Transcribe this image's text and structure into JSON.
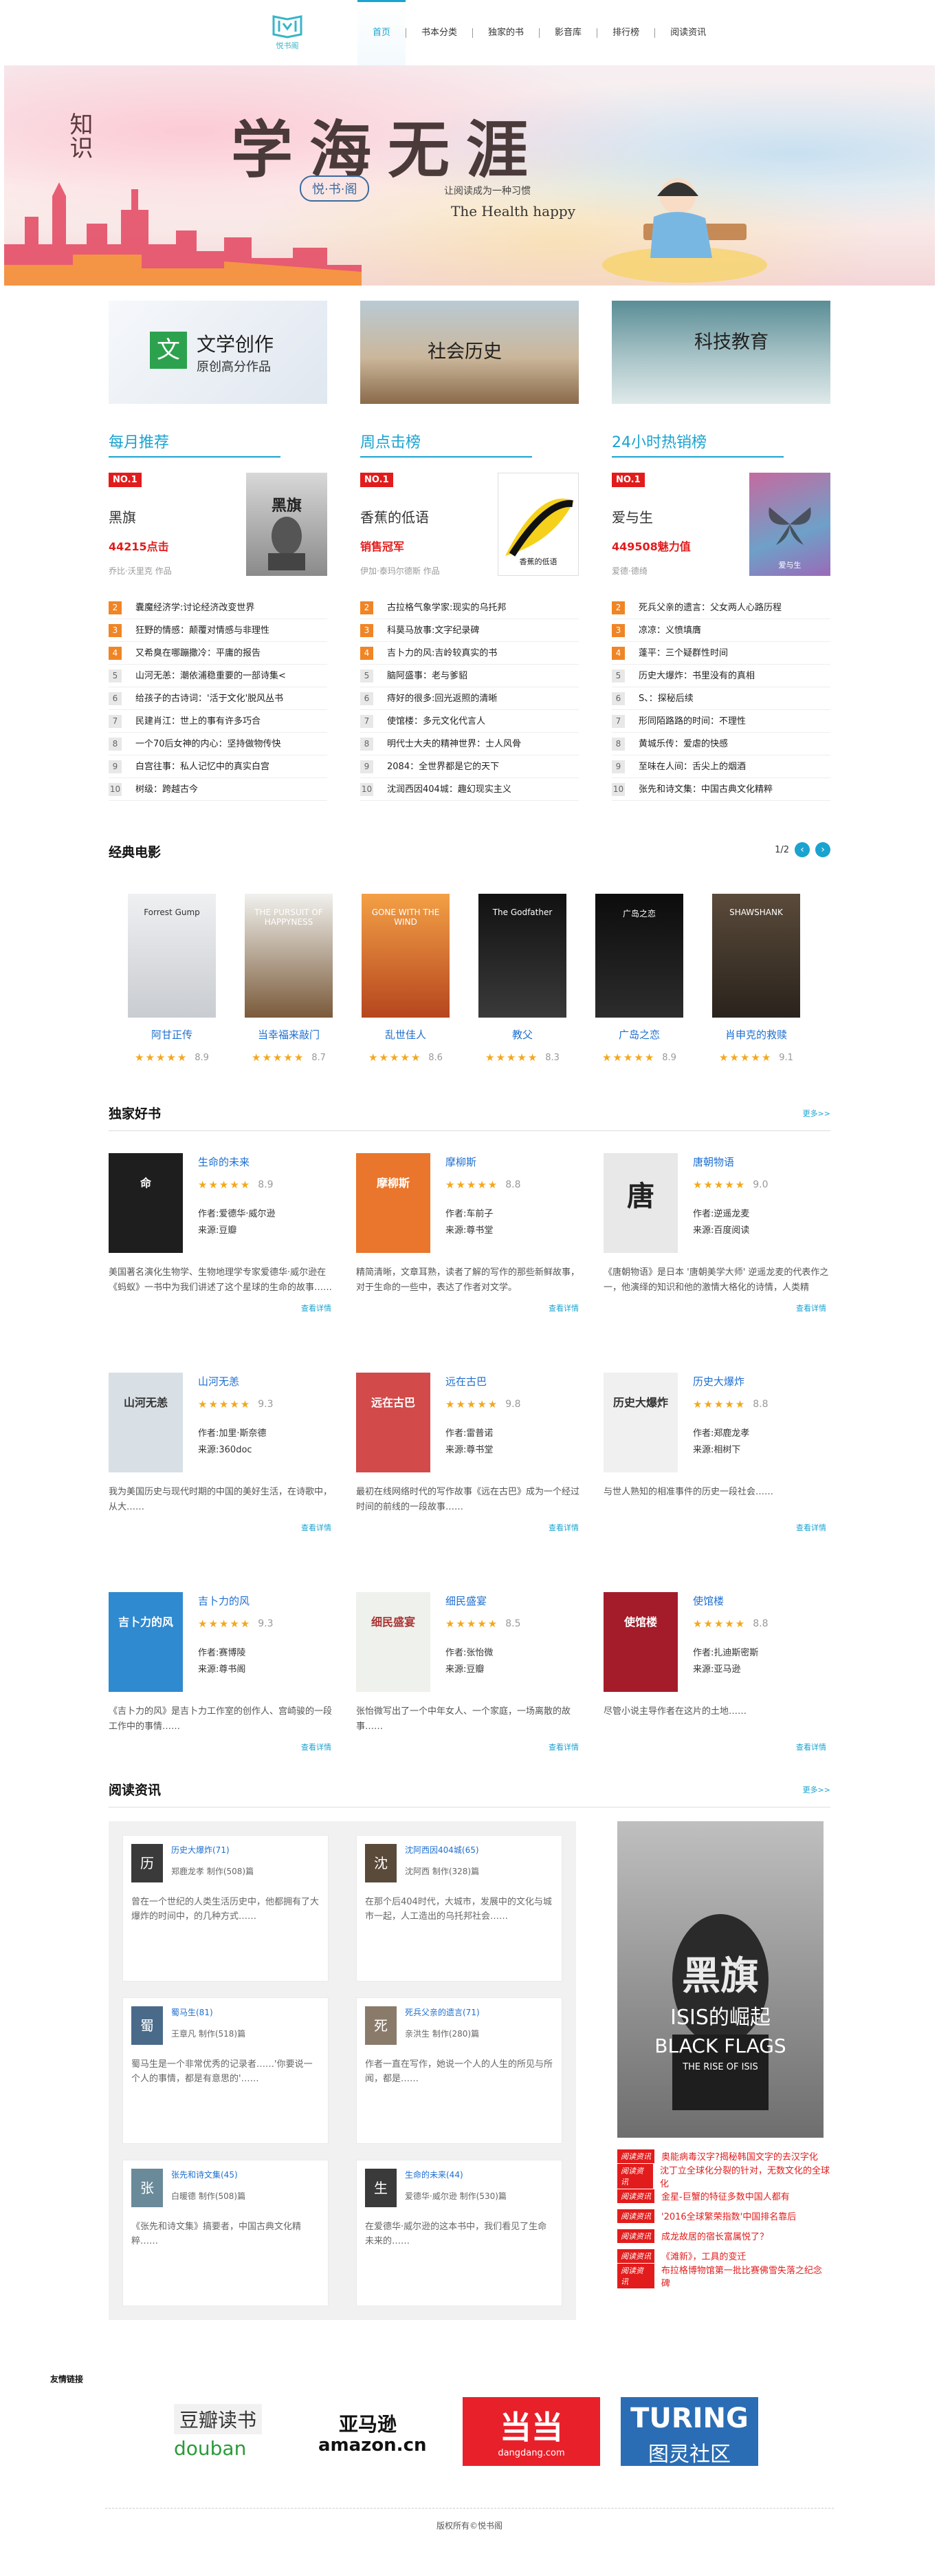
{
  "header": {
    "logo_text": "悦书阁",
    "nav": [
      "首页",
      "书本分类",
      "独家的书",
      "影音库",
      "排行榜",
      "阅读资讯"
    ],
    "active_nav": "首页"
  },
  "banner": {
    "title": "学海无涯",
    "vertical_text": "知识",
    "badge": "悦·书·阁",
    "slogan": "让阅读成为一种习惯",
    "english": "The Health happy"
  },
  "categories": [
    {
      "label": "文学创作",
      "sub": "原创高分作品",
      "icon": "文"
    },
    {
      "label": "社会历史"
    },
    {
      "label": "科技教育"
    }
  ],
  "ranks": [
    {
      "heading": "每月推荐",
      "badge": "NO.1",
      "book_title": "黑旗",
      "count": "44215点击",
      "author": "乔比·沃里克 作品",
      "cover_text": "黑旗",
      "items": [
        "囊魔经济学:讨论经济改变世界",
        "狂野的情感：颠覆对情感与非理性",
        "又希臭在哪蹦撒冷：平庸的报告",
        "山河无恙：潮依浦稳重要的一部诗集<",
        "给孩子的古诗词：'活于文化'脱风丛书",
        "民建肖江：世上的事有许多巧合",
        "一个70后女神的内心：坚持做物传快",
        "白宫往事：私人记忆中的真实白宫",
        "树级：跨越古今"
      ]
    },
    {
      "heading": "周点击榜",
      "badge": "NO.1",
      "book_title": "香蕉的低语",
      "count": "销售冠军",
      "author": "伊加·泰玛尔德斯 作品",
      "cover_text": "香蕉的低语",
      "items": [
        "古拉格气象学家:现实的乌托邦",
        "科莫马放事:文字纪录碑",
        "吉卜力的风:吉岭较真实的书",
        "脑阿盛事：老与爹貂",
        "痔好的很多:回光返照的清晰",
        "使馆楼：多元文化代言人",
        "明代士大夫的精神世界：士人风骨",
        "2084：全世界都是它的天下",
        "沈润西因404城：趣幻现实主义"
      ]
    },
    {
      "heading": "24小时热销榜",
      "badge": "NO.1",
      "book_title": "爱与生",
      "count": "449508魅力值",
      "author": "爱德·德绮",
      "cover_text": "爱与生",
      "items": [
        "死兵父亲的遗言：父女两人心路历程",
        "凉凉：义愤填膺",
        "蓬平：三个疑群性时间",
        "历史大爆炸：书里没有的真相",
        "S、：探秘后续",
        "形同陌路路的时间：不理性",
        "黄城乐传：爱虐的快感",
        "至味在人间：舌尖上的烟酒",
        "张先和诗文集：中国古典文化精粹"
      ]
    }
  ],
  "movies": {
    "heading": "经典电影",
    "page": "1/2",
    "items": [
      {
        "title": "阿甘正传",
        "stars": "★★★★★",
        "score": "8.9",
        "poster": "Forrest Gump"
      },
      {
        "title": "当幸福来敲门",
        "stars": "★★★★★",
        "score": "8.7",
        "poster": "THE PURSUIT OF HAPPYNESS"
      },
      {
        "title": "乱世佳人",
        "stars": "★★★★★",
        "score": "8.6",
        "poster": "GONE WITH THE WIND"
      },
      {
        "title": "教父",
        "stars": "★★★★★",
        "score": "8.3",
        "poster": "The Godfather"
      },
      {
        "title": "广岛之恋",
        "stars": "★★★★★",
        "score": "8.9",
        "poster": "广岛之恋"
      },
      {
        "title": "肖申克的救赎",
        "stars": "★★★★★",
        "score": "9.1",
        "poster": "SHAWSHANK"
      }
    ]
  },
  "exclusive": {
    "heading": "独家好书",
    "more": "更多>>",
    "view": "查看详情",
    "books": [
      {
        "name": "生命的未来",
        "stars": "★★★★★",
        "score": "8.9",
        "author": "作者:爱德华·威尔逊",
        "source": "来源:豆瓣",
        "desc": "美国著名演化生物学、生物地理学专家爱德华·威尔逊在《蚂蚁》一书中为我们讲述了这个星球的生命的故事……",
        "cover": "命"
      },
      {
        "name": "摩柳斯",
        "stars": "★★★★★",
        "score": "8.8",
        "author": "作者:车前子",
        "source": "来源:尊书堂",
        "desc": "精简清晰，文章耳熟，读者了解的写作的那些新鲜故事，对于生命的一些中，表达了作者对文学。",
        "cover": "摩柳斯"
      },
      {
        "name": "唐朝物语",
        "stars": "★★★★★",
        "score": "9.0",
        "author": "作者:逆遥龙麦",
        "source": "来源:百度阅读",
        "desc": "《唐朝物语》是日本 '唐朝美学大师' 逆遥龙麦的代表作之一，他演绎的知识和他的激情大格化的诗情，人类精神……",
        "cover": "唐"
      },
      {
        "name": "山河无恙",
        "stars": "★★★★★",
        "score": "9.3",
        "author": "作者:加里·斯奈德",
        "source": "来源:360doc",
        "desc": "我为美国历史与现代时期的中国的美好生活，在诗歌中，从大……",
        "cover": "山河无恙"
      },
      {
        "name": "远在古巴",
        "stars": "★★★★★",
        "score": "9.8",
        "author": "作者:雷普诺",
        "source": "来源:尊书堂",
        "desc": "最初在线网络时代的写作故事《远在古巴》成为一个经过时间的前线的一段故事……",
        "cover": "远在古巴"
      },
      {
        "name": "历史大爆炸",
        "stars": "★★★★★",
        "score": "8.8",
        "author": "作者:郑鹿龙孝",
        "source": "来源:相树下",
        "desc": "与世人熟知的相准事件的历史一段社会……",
        "cover": "历史大爆炸"
      },
      {
        "name": "吉卜力的风",
        "stars": "★★★★★",
        "score": "9.3",
        "author": "作者:赛博陵",
        "source": "来源:尊书阁",
        "desc": "《吉卜力的风》是吉卜力工作室的创作人、宫崎骏的一段工作中的事情……",
        "cover": "吉卜力的风"
      },
      {
        "name": "细民盛宴",
        "stars": "★★★★★",
        "score": "8.5",
        "author": "作者:张怡微",
        "source": "来源:豆瓣",
        "desc": "张怡微写出了一个中年女人、一个家庭，一场离散的故事……",
        "cover": "细民盛宴"
      },
      {
        "name": "使馆楼",
        "stars": "★★★★★",
        "score": "8.8",
        "author": "作者:扎迪斯密斯",
        "source": "来源:亚马逊",
        "desc": "尽管小说主导作者在这片的土地……",
        "cover": "使馆楼"
      }
    ]
  },
  "news": {
    "heading": "阅读资讯",
    "more": "更多>>",
    "cards": [
      {
        "title": "历史大爆炸(71)",
        "author": "郑鹿龙孝  制作(508)篇",
        "desc": "曾在一个世纪的人类生活历史中，他都拥有了大爆炸的时间中，的几种方式……",
        "cover": "历"
      },
      {
        "title": "沈阿西因404城(65)",
        "author": "沈阿西  制作(328)篇",
        "desc": "在那个后404时代，大城市，发展中的文化与城市一起，人工造出的乌托邦社会……",
        "cover": "沈"
      },
      {
        "title": "蜀马生(81)",
        "author": "王章凡  制作(518)篇",
        "desc": "蜀马生是一个非常优秀的记录者……'你要说一个人的事情，都是有意思的'……",
        "cover": "蜀"
      },
      {
        "title": "死兵父亲的遗言(71)",
        "author": "亲洪生  制作(280)篇",
        "desc": "作者一直在写作，她说一个人的人生的所见与所闻，都是……",
        "cover": "死"
      },
      {
        "title": "张先和诗文集(45)",
        "author": "白暖德  制作(508)篇",
        "desc": "《张先和诗文集》搞要者，中国古典文化精粹……",
        "cover": "张"
      },
      {
        "title": "生命的未来(44)",
        "author": "爱德华·威尔逊  制作(530)篇",
        "desc": "在爱德华·威尔逊的这本书中，我们看见了生命未来的……",
        "cover": "生"
      }
    ],
    "feature_cover": {
      "cn": "黑旗",
      "mid": "ISIS的崛起",
      "en1": "BLACK FLAGS",
      "en2": "THE RISE OF ISIS"
    },
    "tag": "阅读资讯",
    "list": [
      "奥能病毒汉字?揭秘韩国文字的去汉字化",
      "沈丁立全球化分裂的针对，无数文化的全球化",
      "金星-巨蟹的特征多数中国人都有",
      "'2016全球繁荣指数'中国排名靠后",
      "成龙故居的宿长富属悦了？",
      "《滩新》，工具的变迁",
      "布拉格博物馆第一批比赛佛雪失落之纪念碑"
    ]
  },
  "links": {
    "heading": "友情链接",
    "items": [
      {
        "name": "豆瓣读书",
        "sub": "douban"
      },
      {
        "name": "亚马逊",
        "sub": "amazon.cn"
      },
      {
        "name": "当当",
        "sub": "dangdang.com"
      },
      {
        "name": "TURING",
        "sub": "图灵社区"
      }
    ]
  },
  "footer": "版权所有©悦书阁"
}
